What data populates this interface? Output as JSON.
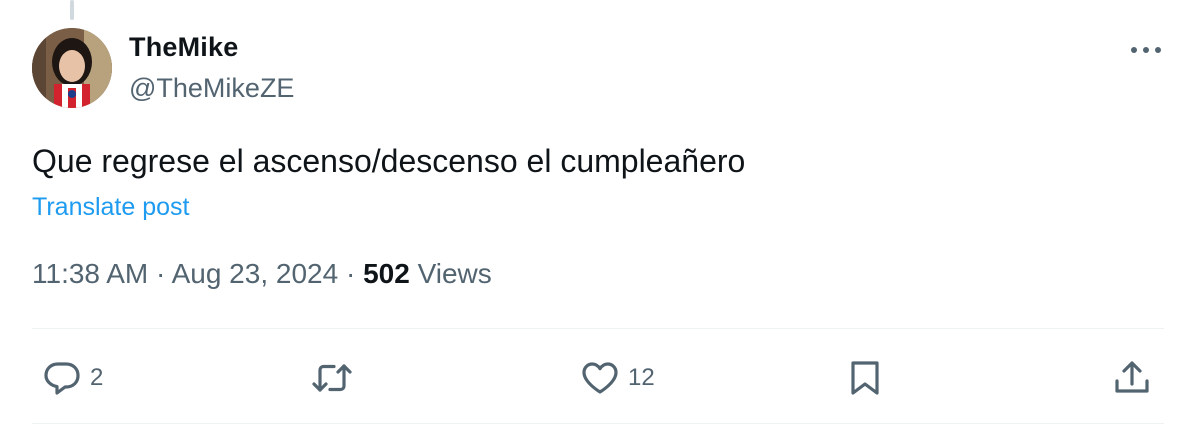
{
  "post": {
    "author": {
      "name": "TheMike",
      "handle": "@TheMikeZE",
      "avatar_icon": "profile-photo"
    },
    "text": "Que regrese el ascenso/descenso el cumpleañero",
    "translate_label": "Translate post",
    "time": "11:38 AM",
    "separator": "·",
    "date": "Aug 23, 2024",
    "views_count": "502",
    "views_label": "Views"
  },
  "actions": {
    "reply": {
      "icon": "reply-icon",
      "count": "2"
    },
    "repost": {
      "icon": "repost-icon",
      "count": ""
    },
    "like": {
      "icon": "heart-icon",
      "count": "12"
    },
    "bookmark": {
      "icon": "bookmark-icon"
    },
    "share": {
      "icon": "share-icon"
    }
  },
  "colors": {
    "text": "#0f1419",
    "secondary": "#536471",
    "link": "#1d9bf0",
    "divider": "#eff3f4"
  }
}
